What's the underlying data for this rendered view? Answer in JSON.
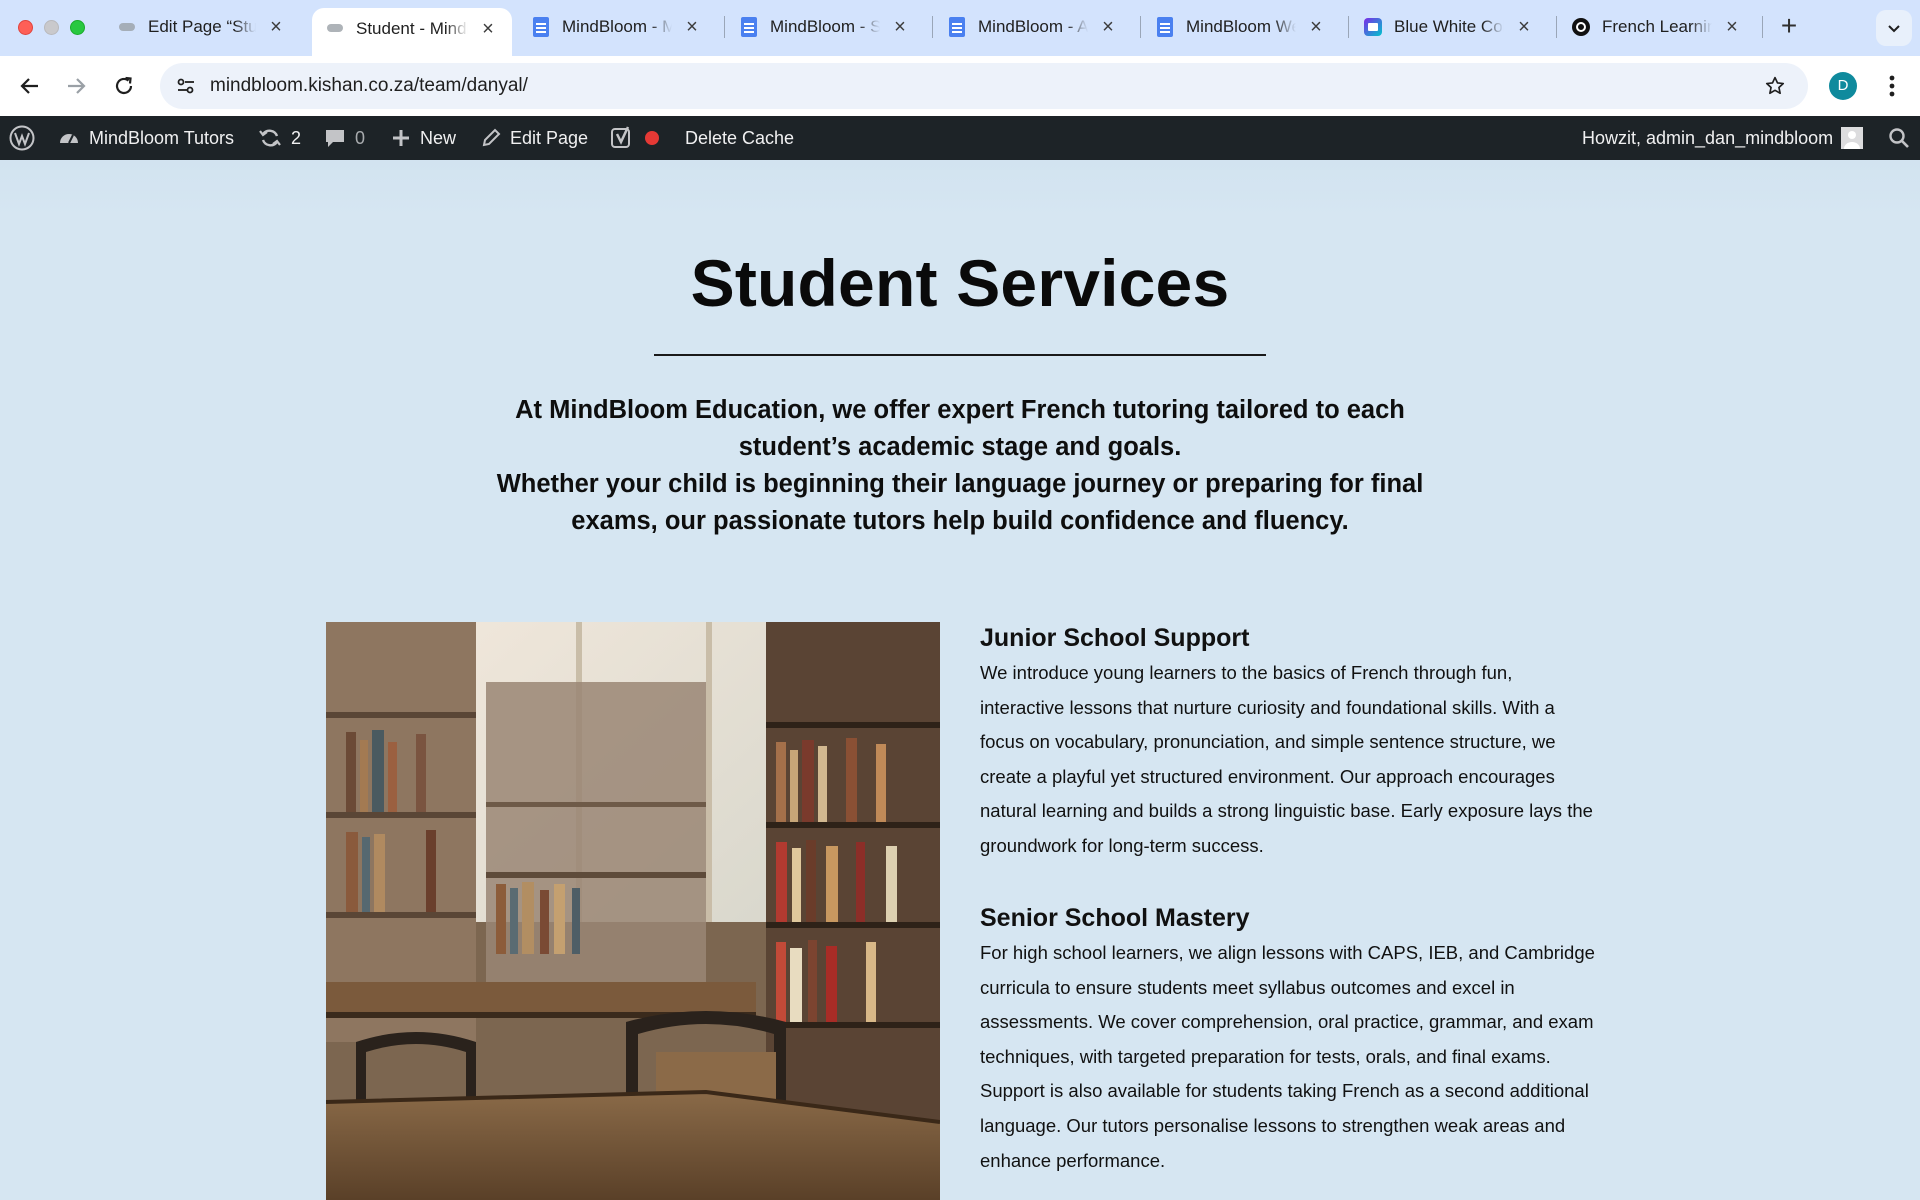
{
  "browser": {
    "tabs": [
      {
        "title": "Edit Page “Student Services”",
        "icon": "cloud-icon",
        "active": false
      },
      {
        "title": "Student - MindBloom",
        "icon": "cloud-icon",
        "active": true
      },
      {
        "title": "MindBloom - M",
        "icon": "google-docs-icon",
        "active": false
      },
      {
        "title": "MindBloom - S",
        "icon": "google-docs-icon",
        "active": false
      },
      {
        "title": "MindBloom - A",
        "icon": "google-docs-icon",
        "active": false
      },
      {
        "title": "MindBloom Website",
        "icon": "google-docs-icon",
        "active": false
      },
      {
        "title": "Blue White Color",
        "icon": "canva-icon",
        "active": false
      },
      {
        "title": "French Learning",
        "icon": "chatgpt-icon",
        "active": false
      }
    ],
    "url": "mindbloom.kishan.co.za/team/danyal/",
    "profile_initial": "D"
  },
  "adminbar": {
    "site_name": "MindBloom Tutors",
    "updates_count": "2",
    "comments_count": "0",
    "new_label": "New",
    "edit_label": "Edit Page",
    "delete_cache_label": "Delete Cache",
    "greeting": "Howzit, admin_dan_mindbloom"
  },
  "page": {
    "title": "Student Services",
    "intro_line1": "At MindBloom Education, we offer expert French tutoring tailored to each student’s academic stage and goals.",
    "intro_line2": "Whether your child is beginning their language journey or preparing for final exams, our passionate tutors help build confidence and fluency.",
    "services": [
      {
        "heading": "Junior School Support",
        "body": "We introduce young learners to the basics of French through fun, interactive lessons that nurture curiosity and foundational skills. With a focus on vocabulary, pronunciation, and simple sentence structure, we create a playful yet structured environment. Our approach encourages natural learning and builds a strong linguistic base. Early exposure lays the groundwork for long-term success."
      },
      {
        "heading": "Senior School Mastery",
        "body": "For high school learners, we align lessons with CAPS, IEB, and Cambridge curricula to ensure students meet syllabus outcomes and excel in assessments. We cover comprehension, oral practice, grammar, and exam techniques, with targeted preparation for tests, orals, and final exams. Support is also available for students taking French as a second additional language. Our tutors personalise lessons to strengthen weak areas and enhance performance."
      }
    ]
  },
  "colors": {
    "tabstrip": "#d3e3fd",
    "adminbar": "#1d2327",
    "page_bg": "#d6e6f2",
    "recording_dot": "#e53935"
  }
}
